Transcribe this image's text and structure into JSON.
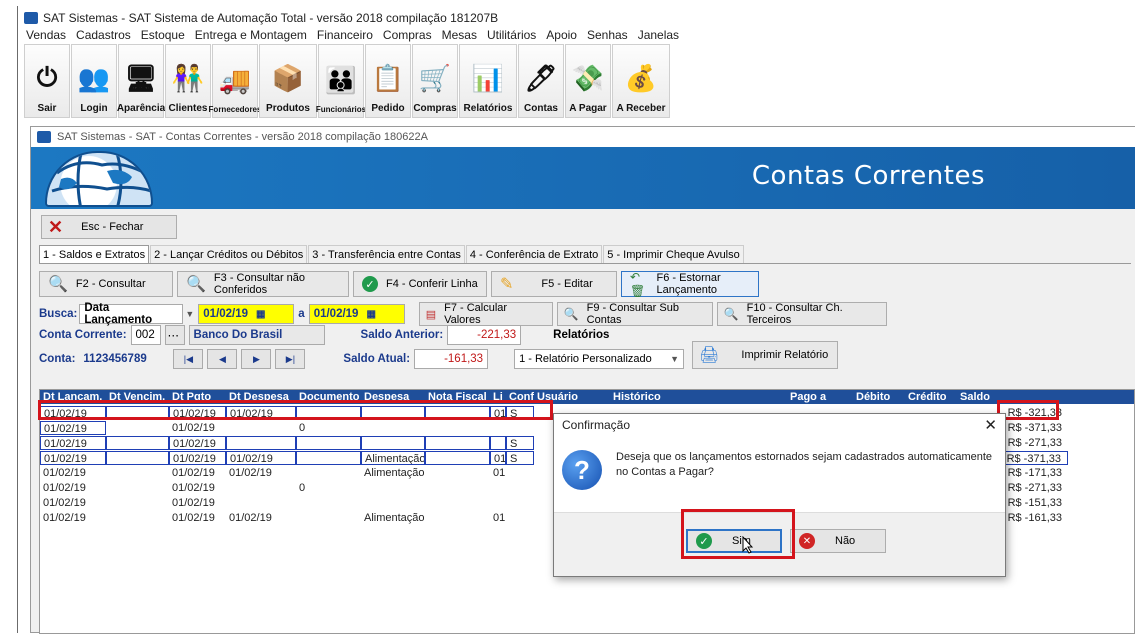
{
  "window": {
    "title": "SAT Sistemas - SAT Sistema de Automação Total - versão 2018 compilação 181207B"
  },
  "menu": [
    "Vendas",
    "Cadastros",
    "Estoque",
    "Entrega e Montagem",
    "Financeiro",
    "Compras",
    "Mesas",
    "Utilitários",
    "Apoio",
    "Senhas",
    "Janelas"
  ],
  "toolbar": [
    {
      "label": "Sair",
      "icon": "power-icon"
    },
    {
      "label": "Login",
      "icon": "users-icon"
    },
    {
      "label": "Aparência",
      "icon": "monitor-icon"
    },
    {
      "label": "Clientes",
      "icon": "people-icon"
    },
    {
      "label": "Fornecedores",
      "icon": "truck-icon"
    },
    {
      "label": "Produtos",
      "icon": "box-icon"
    },
    {
      "label": "Funcionários",
      "icon": "group-icon"
    },
    {
      "label": "Pedido",
      "icon": "document-icon"
    },
    {
      "label": "Compras",
      "icon": "cart-icon"
    },
    {
      "label": "Relatórios",
      "icon": "chart-icon"
    },
    {
      "label": "Contas",
      "icon": "pen-icon"
    },
    {
      "label": "A Pagar",
      "icon": "pay-icon"
    },
    {
      "label": "A Receber",
      "icon": "receive-icon"
    }
  ],
  "child": {
    "title": "SAT Sistemas - SAT - Contas Correntes - versão 2018 compilação 180622A",
    "banner_title": "Contas Correntes",
    "close_label": "Esc - Fechar"
  },
  "tabs": [
    "1 - Saldos e Extratos",
    "2 - Lançar Créditos ou Débitos",
    "3 - Transferência entre Contas",
    "4 - Conferência de Extrato",
    "5 - Imprimir Cheque Avulso"
  ],
  "actions": [
    "F2 - Consultar",
    "F3 - Consultar não Conferidos",
    "F4 - Conferir Linha",
    "F5 - Editar",
    "F6 - Estornar Lançamento"
  ],
  "filter": {
    "busca_label": "Busca:",
    "busca_value": "Data Lançamento",
    "date_from": "01/02/19",
    "a_label": "a",
    "date_to": "01/02/19",
    "calc": "F7 - Calcular Valores",
    "sub": "F9 - Consultar Sub Contas",
    "terc": "F10 - Consultar Ch. Terceiros",
    "conta_corrente_label": "Conta Corrente:",
    "conta_corrente_code": "002",
    "banco": "Banco Do Brasil",
    "saldo_anterior_label": "Saldo Anterior:",
    "saldo_anterior": "-221,33",
    "relatorios_label": "Relatórios",
    "relatorio_value": "1 - Relatório Personalizado",
    "imprimir": "Imprimir Relatório",
    "conta_label": "Conta:",
    "conta_value": "1123456789",
    "saldo_atual_label": "Saldo Atual:",
    "saldo_atual": "-161,33"
  },
  "grid": {
    "headers": [
      "Dt Lançam.",
      "Dt Vencim.",
      "Dt Pgto",
      "Dt Despesa",
      "Documento",
      "Despesa",
      "Nota Fiscal",
      "Li",
      "Conf",
      "Usuário",
      "Histórico",
      "Pago a",
      "Débito",
      "Crédito",
      "Saldo"
    ],
    "rows": [
      {
        "lanc": "01/02/19",
        "pgto": "01/02/19",
        "desp_dt": "01/02/19",
        "doc": "",
        "despesa": "",
        "li": "01",
        "conf": "S",
        "saldo": "R$ -321,33"
      },
      {
        "lanc": "01/02/19",
        "pgto": "01/02/19",
        "desp_dt": "",
        "doc": "0",
        "despesa": "",
        "li": "",
        "conf": "",
        "saldo": "R$ -371,33"
      },
      {
        "lanc": "01/02/19",
        "pgto": "01/02/19",
        "desp_dt": "",
        "doc": "",
        "despesa": "",
        "li": "",
        "conf": "S",
        "saldo": "R$ -271,33"
      },
      {
        "lanc": "01/02/19",
        "pgto": "01/02/19",
        "desp_dt": "01/02/19",
        "doc": "",
        "despesa": "Alimentação",
        "li": "01",
        "conf": "S",
        "saldo": "R$ -371,33"
      },
      {
        "lanc": "01/02/19",
        "pgto": "01/02/19",
        "desp_dt": "01/02/19",
        "doc": "",
        "despesa": "Alimentação",
        "li": "01",
        "conf": "",
        "saldo": "R$ -171,33"
      },
      {
        "lanc": "01/02/19",
        "pgto": "01/02/19",
        "desp_dt": "",
        "doc": "0",
        "despesa": "",
        "li": "",
        "conf": "",
        "saldo": "R$ -271,33"
      },
      {
        "lanc": "01/02/19",
        "pgto": "01/02/19",
        "desp_dt": "",
        "doc": "",
        "despesa": "",
        "li": "",
        "conf": "",
        "saldo": "R$ -151,33"
      },
      {
        "lanc": "01/02/19",
        "pgto": "01/02/19",
        "desp_dt": "01/02/19",
        "doc": "",
        "despesa": "Alimentação",
        "li": "01",
        "conf": "",
        "saldo": "R$ -161,33"
      }
    ]
  },
  "dialog": {
    "title": "Confirmação",
    "message": "Deseja que os lançamentos estornados sejam cadastrados automaticamente no Contas a Pagar?",
    "yes": "Sim",
    "no": "Não"
  },
  "colors": {
    "banner": "#1c78c2",
    "grid_header": "#1f4f9a",
    "highlight": "#d4141c",
    "date_bg": "#ffff00"
  }
}
